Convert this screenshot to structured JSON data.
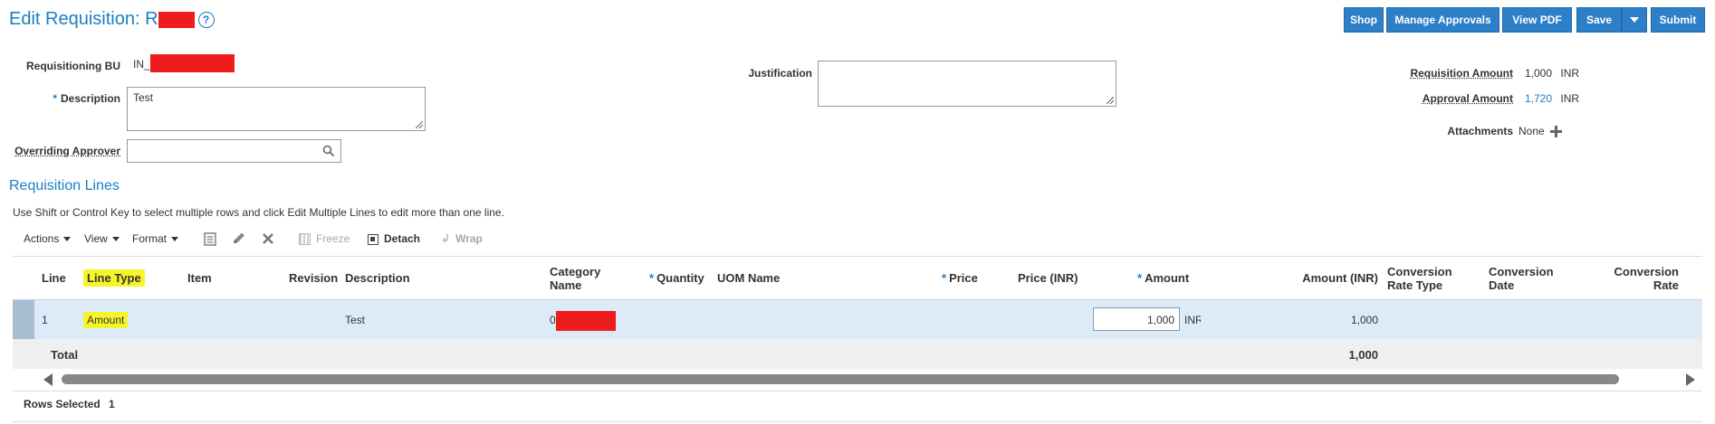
{
  "page": {
    "title": "Edit Requisition: R",
    "help_icon": "?"
  },
  "actions": {
    "shop": "Shop",
    "manage_approvals": "Manage Approvals",
    "view_pdf": "View PDF",
    "save": "Save",
    "submit": "Submit"
  },
  "header": {
    "requisitioning_bu_label": "Requisitioning BU",
    "requisitioning_bu_value": "IN_",
    "description_label": "Description",
    "description_value": "Test",
    "overriding_approver_label": "Overriding Approver",
    "overriding_approver_value": "",
    "justification_label": "Justification",
    "justification_value": "",
    "requisition_amount_label": "Requisition Amount",
    "requisition_amount_value": "1,000",
    "requisition_amount_currency": "INR",
    "approval_amount_label": "Approval Amount",
    "approval_amount_value": "1,720",
    "approval_amount_currency": "INR",
    "attachments_label": "Attachments",
    "attachments_value": "None"
  },
  "lines": {
    "section_title": "Requisition Lines",
    "hint": "Use Shift or Control Key to select multiple rows and click Edit Multiple Lines to edit more than one line.",
    "toolbar": {
      "actions": "Actions",
      "view": "View",
      "format": "Format",
      "freeze": "Freeze",
      "detach": "Detach",
      "wrap": "Wrap"
    },
    "columns": {
      "line": "Line",
      "line_type": "Line Type",
      "item": "Item",
      "revision": "Revision",
      "description": "Description",
      "category_name_1": "Category",
      "category_name_2": "Name",
      "quantity": "Quantity",
      "uom_name": "UOM Name",
      "price": "Price",
      "price_inr": "Price (INR)",
      "amount": "Amount",
      "amount_inr": "Amount (INR)",
      "conv_rate_type_1": "Conversion",
      "conv_rate_type_2": "Rate Type",
      "conv_date_1": "Conversion",
      "conv_date_2": "Date",
      "conv_rate_1": "Conversion",
      "conv_rate_2": "Rate"
    },
    "rows": [
      {
        "line": "1",
        "line_type": "Amount",
        "description": "Test",
        "category_name": "0",
        "amount": "1,000",
        "amount_currency": "INR",
        "amount_inr": "1,000"
      }
    ],
    "total_label": "Total",
    "total_amount_inr": "1,000",
    "rows_selected_label": "Rows Selected",
    "rows_selected_value": "1"
  },
  "colors": {
    "accent": "#1a7ec4",
    "button": "#2d7fc8",
    "redaction": "#ee1c1c",
    "highlight": "#f5f52a"
  }
}
